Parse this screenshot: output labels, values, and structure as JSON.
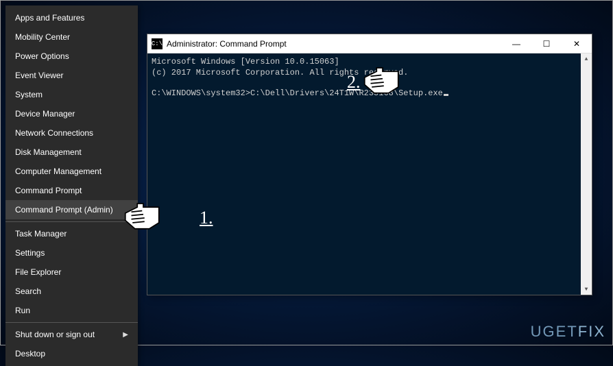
{
  "winx": {
    "items": [
      {
        "label": "Apps and Features"
      },
      {
        "label": "Mobility Center"
      },
      {
        "label": "Power Options"
      },
      {
        "label": "Event Viewer"
      },
      {
        "label": "System"
      },
      {
        "label": "Device Manager"
      },
      {
        "label": "Network Connections"
      },
      {
        "label": "Disk Management"
      },
      {
        "label": "Computer Management"
      },
      {
        "label": "Command Prompt"
      },
      {
        "label": "Command Prompt (Admin)",
        "highlight": true
      }
    ],
    "items2": [
      {
        "label": "Task Manager"
      },
      {
        "label": "Settings"
      },
      {
        "label": "File Explorer"
      },
      {
        "label": "Search"
      },
      {
        "label": "Run"
      }
    ],
    "items3": [
      {
        "label": "Shut down or sign out",
        "submenu": true
      },
      {
        "label": "Desktop"
      }
    ]
  },
  "cmd": {
    "icon_text": "C:\\",
    "title": "Administrator: Command Prompt",
    "lines": {
      "l1": "Microsoft Windows [Version 10.0.15063]",
      "l2": "(c) 2017 Microsoft Corporation. All rights reserved.",
      "prompt": "C:\\WINDOWS\\system32>",
      "input": "C:\\Dell\\Drivers\\24T1W\\R235168\\Setup.exe"
    },
    "controls": {
      "min": "—",
      "max": "☐",
      "close": "✕"
    },
    "scroll": {
      "up": "▲",
      "down": "▼"
    }
  },
  "annotations": {
    "one": "1.",
    "two": "2."
  },
  "watermark": {
    "a": "UGET",
    "b": "FIX"
  }
}
